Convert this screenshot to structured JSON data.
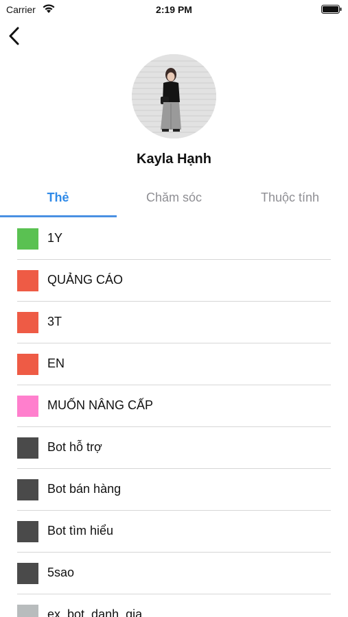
{
  "status_bar": {
    "carrier": "Carrier",
    "time": "2:19 PM",
    "wifi_icon": "wifi-icon",
    "battery_icon": "battery-icon"
  },
  "nav": {
    "back_icon": "chevron-left-icon"
  },
  "profile": {
    "name": "Kayla Hạnh",
    "avatar": "user-photo"
  },
  "tabs": [
    {
      "label": "Thẻ",
      "active": true
    },
    {
      "label": "Chăm sóc",
      "active": false
    },
    {
      "label": "Thuộc tính",
      "active": false
    }
  ],
  "colors": {
    "accent": "#2f8ae8",
    "green": "#5ac152",
    "red": "#ee5b45",
    "pink": "#ff7fcd",
    "dark": "#4a4a4a",
    "gray": "#b8bcbd"
  },
  "tags": [
    {
      "label": "1Y",
      "color": "#5ac152"
    },
    {
      "label": "QUẢNG CÁO",
      "color": "#ee5b45"
    },
    {
      "label": "3T",
      "color": "#ee5b45"
    },
    {
      "label": "EN",
      "color": "#ee5b45"
    },
    {
      "label": "MUỐN NÂNG CẤP",
      "color": "#ff7fcd"
    },
    {
      "label": "Bot hỗ trợ",
      "color": "#4a4a4a"
    },
    {
      "label": "Bot bán hàng",
      "color": "#4a4a4a"
    },
    {
      "label": "Bot tìm hiểu",
      "color": "#4a4a4a"
    },
    {
      "label": "5sao",
      "color": "#4a4a4a"
    },
    {
      "label": "ex_bot_danh_gia",
      "color": "#b8bcbd"
    }
  ]
}
